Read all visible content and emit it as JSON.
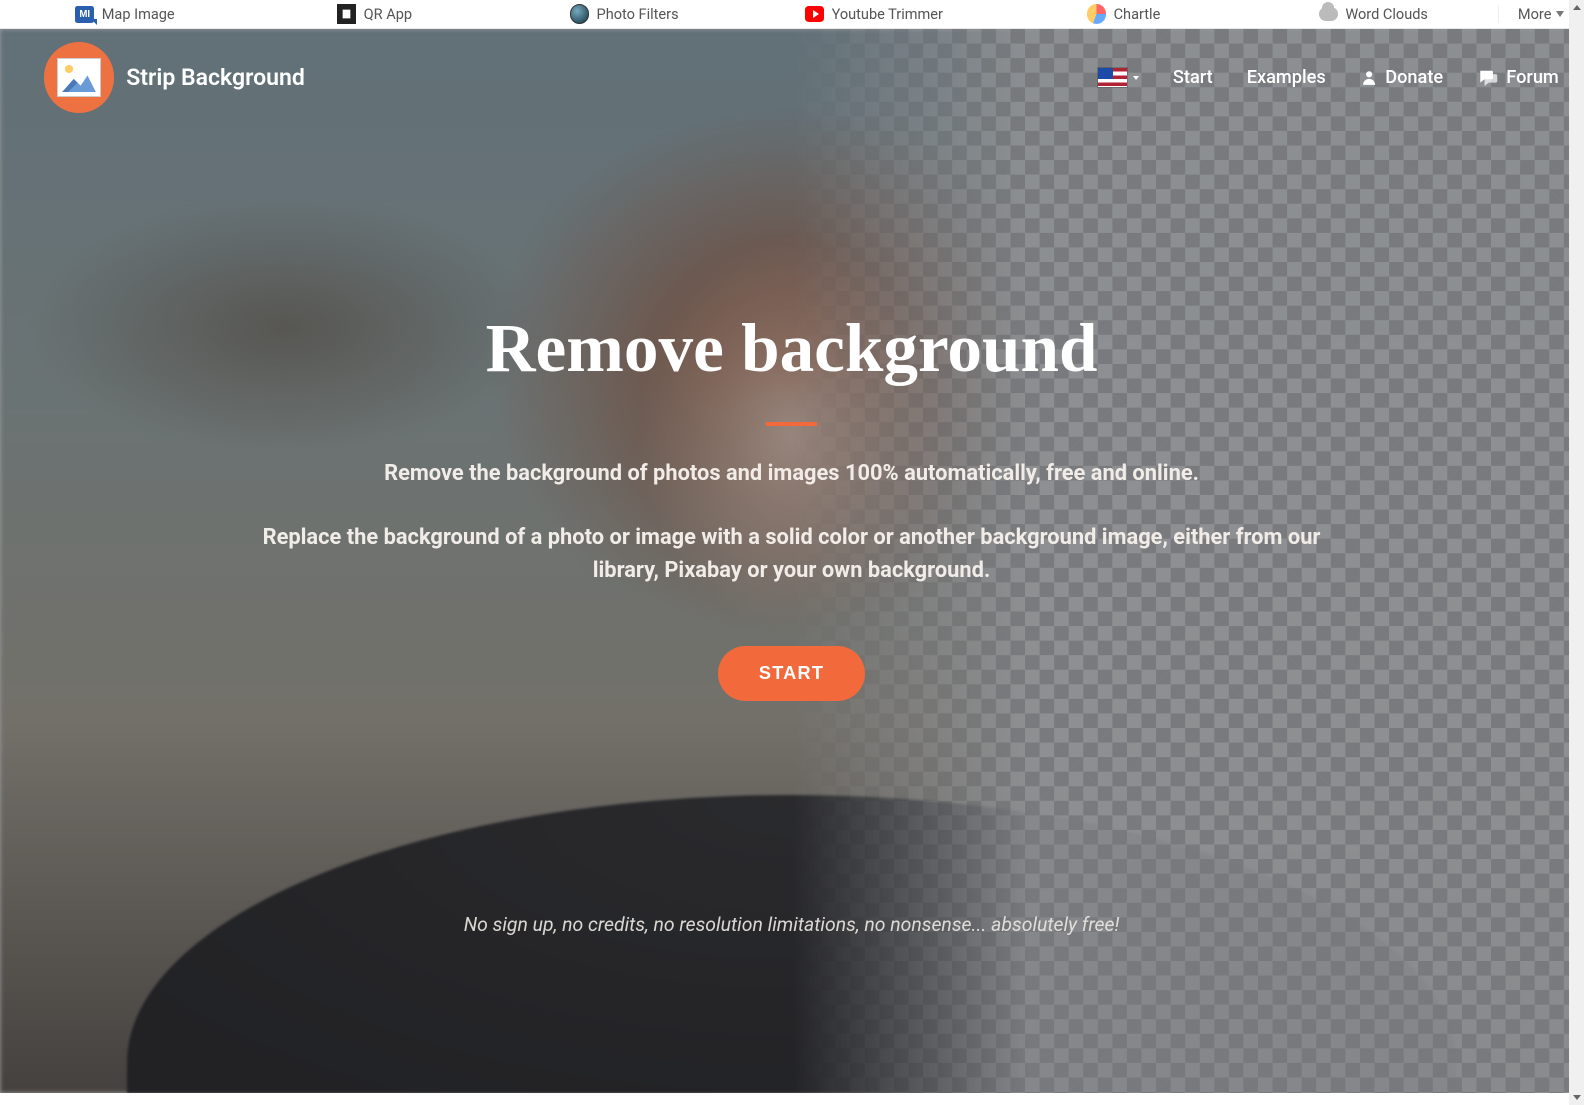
{
  "topbar": {
    "items": [
      {
        "label": "Map Image"
      },
      {
        "label": "QR App"
      },
      {
        "label": "Photo Filters"
      },
      {
        "label": "Youtube Trimmer"
      },
      {
        "label": "Chartle"
      },
      {
        "label": "Word Clouds"
      }
    ],
    "more": "More"
  },
  "brand": "Strip Background",
  "nav": {
    "start": "Start",
    "examples": "Examples",
    "donate": "Donate",
    "forum": "Forum"
  },
  "hero": {
    "title": "Remove background",
    "subtitle1": "Remove the background of photos and images 100% automatically, free and online.",
    "subtitle2": "Replace the background of a photo or image with a solid color or another background image, either from our library, Pixabay or your own background.",
    "cta": "START",
    "footnote": "No sign up, no credits, no resolution limitations, no nonsense... absolutely free!"
  },
  "colors": {
    "accent": "#f26a3b"
  }
}
